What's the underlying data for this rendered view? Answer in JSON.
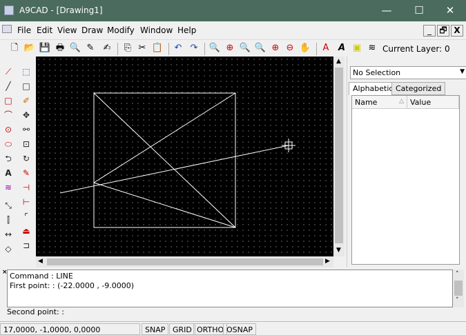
{
  "window": {
    "title": "A9CAD - [Drawing1]",
    "minimize": "—",
    "maximize": "☐",
    "close": "✕"
  },
  "menu": [
    "File",
    "Edit",
    "View",
    "Draw",
    "Modify",
    "Window",
    "Help"
  ],
  "mdi": {
    "minimize": "_",
    "restore": "🗗",
    "close": "X"
  },
  "toolbar": {
    "current_layer": "Current Layer: 0"
  },
  "panel": {
    "selection": "No Selection",
    "tabs": [
      "Alphabetic",
      "Categorized"
    ],
    "columns": [
      "Name",
      "Value"
    ]
  },
  "command": {
    "lines": [
      "Command : LINE",
      "First point: : (-22.0000 , -9.0000)"
    ],
    "prompt": "Second point: :"
  },
  "status": {
    "coords": "17,0000, -1,0000, 0,0000",
    "snap": "SNAP",
    "grid": "GRID",
    "ortho": "ORTHO",
    "osnap": "OSNAP"
  }
}
